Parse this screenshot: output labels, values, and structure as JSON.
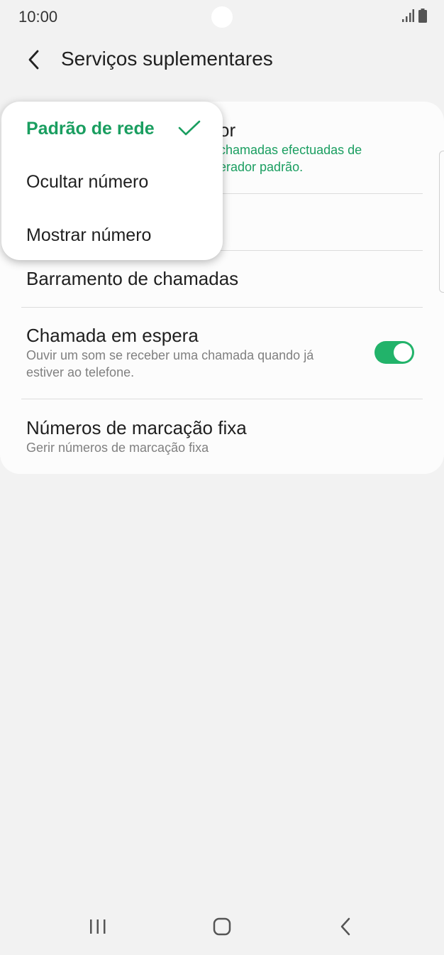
{
  "status_bar": {
    "time": "10:00"
  },
  "header": {
    "title": "Serviços suplementares"
  },
  "settings": {
    "caller_id": {
      "title_visible": "or",
      "sub_line1": "chamadas efectuadas de",
      "sub_line2": "erador padrão."
    },
    "call_barring": {
      "title": "Barramento de chamadas"
    },
    "call_waiting": {
      "title": "Chamada em espera",
      "sub_line1": "Ouvir um som se receber uma chamada quando já",
      "sub_line2": "estiver ao telefone.",
      "enabled": true
    },
    "fixed_dialing": {
      "title": "Números de marcação fixa",
      "subtitle": "Gerir números de marcação fixa"
    }
  },
  "popup": {
    "options": [
      {
        "label": "Padrão de rede",
        "selected": true
      },
      {
        "label": "Ocultar número",
        "selected": false
      },
      {
        "label": "Mostrar número",
        "selected": false
      }
    ]
  },
  "colors": {
    "accent": "#1a9e60",
    "toggle_on": "#22b36a"
  },
  "icons": {
    "back": "chevron-left-icon",
    "check": "check-icon",
    "nav_recents": "recents-icon",
    "nav_home": "home-icon",
    "nav_back": "back-icon"
  }
}
